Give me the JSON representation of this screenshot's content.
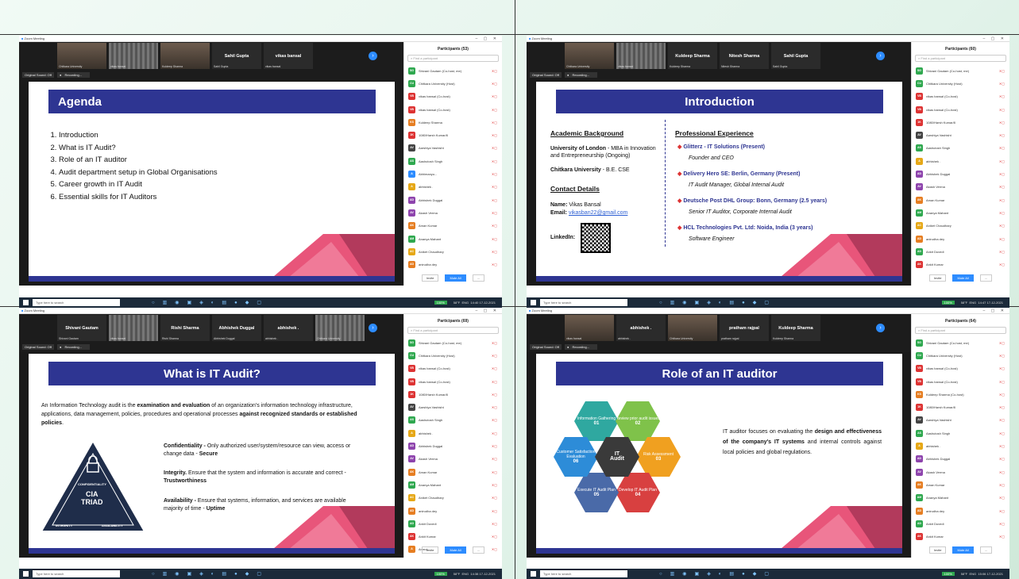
{
  "q1": {
    "window_title": "Zoom Meeting",
    "participants_count": "Participants (53)",
    "tiles": [
      {
        "name": "",
        "sub": "Chitkara University"
      },
      {
        "name": "",
        "sub": "vikas bansal"
      },
      {
        "name": "",
        "sub": "Kuldeep Sharma"
      },
      {
        "name": "Sahil Gupta",
        "sub": "Sahil Gupta"
      },
      {
        "name": "vikas bansal",
        "sub": "vikas bansal"
      }
    ],
    "participants": [
      {
        "i": "SG",
        "c": "#2fa84f",
        "n": "Shivani Gautam (Co-host, me)"
      },
      {
        "i": "CU",
        "c": "#2fa84f",
        "n": "Chitkara University (Host)"
      },
      {
        "i": "VB",
        "c": "#d33",
        "n": "vikas bansal (Co-host)"
      },
      {
        "i": "VB",
        "c": "#d33",
        "n": "vikas bansal (Co-host)"
      },
      {
        "i": "KS",
        "c": "#e67e22",
        "n": "Kuldeep Sharma"
      },
      {
        "i": "1K",
        "c": "#d33",
        "n": "1080/Harsh Kumar/8"
      },
      {
        "i": "AV",
        "c": "#444",
        "n": "Aarshiya Vashisht"
      },
      {
        "i": "AS",
        "c": "#2fa84f",
        "n": "Aashutosh Singh"
      },
      {
        "i": "A",
        "c": "#2d8cff",
        "n": "Abhimanyu..."
      },
      {
        "i": "A",
        "c": "#e6a817",
        "n": "abhishek ."
      },
      {
        "i": "AD",
        "c": "#8e44ad",
        "n": "Abhishek Duggal"
      },
      {
        "i": "AV",
        "c": "#8e44ad",
        "n": "Akash Verma"
      },
      {
        "i": "AK",
        "c": "#e67e22",
        "n": "Aman Kumar"
      },
      {
        "i": "AM",
        "c": "#2fa84f",
        "n": "Ananya Mahant"
      },
      {
        "i": "AC",
        "c": "#e6a817",
        "n": "Aniket Chaudhary"
      },
      {
        "i": "AD",
        "c": "#e67e22",
        "n": "anirudha dey"
      }
    ],
    "slide": {
      "title": "Agenda",
      "items": [
        "Introduction",
        "What is IT Audit?",
        "Role of an IT auditor",
        "Audit department setup in Global Organisations",
        "Career growth in IT Audit",
        "Essential skills for IT Auditors"
      ]
    }
  },
  "q2": {
    "window_title": "Zoom Meeting",
    "participants_count": "Participants (60)",
    "tiles": [
      {
        "name": "",
        "sub": "Chitkara University"
      },
      {
        "name": "",
        "sub": "vikas bansal"
      },
      {
        "name": "Kuldeep Sharma",
        "sub": "Kuldeep Sharma"
      },
      {
        "name": "Nitesh Sharma",
        "sub": "Nitesh Sharma"
      },
      {
        "name": "Sahil Gupta",
        "sub": "Sahil Gupta"
      }
    ],
    "participants": [
      {
        "i": "SG",
        "c": "#2fa84f",
        "n": "Shivani Gautam (Co-host, me)"
      },
      {
        "i": "CU",
        "c": "#2fa84f",
        "n": "Chitkara University (Host)"
      },
      {
        "i": "VB",
        "c": "#d33",
        "n": "vikas bansal (Co-host)"
      },
      {
        "i": "VB",
        "c": "#d33",
        "n": "vikas bansal (Co-host)"
      },
      {
        "i": "1K",
        "c": "#d33",
        "n": "1080/Harsh Kumar/8"
      },
      {
        "i": "AV",
        "c": "#444",
        "n": "Aarshiya Vashisht"
      },
      {
        "i": "AS",
        "c": "#2fa84f",
        "n": "Aashutosh Singh"
      },
      {
        "i": "A",
        "c": "#e6a817",
        "n": "abhishek ."
      },
      {
        "i": "AD",
        "c": "#8e44ad",
        "n": "Abhishek Duggal"
      },
      {
        "i": "AV",
        "c": "#8e44ad",
        "n": "Akash Verma"
      },
      {
        "i": "AK",
        "c": "#e67e22",
        "n": "Aman Kumar"
      },
      {
        "i": "AM",
        "c": "#2fa84f",
        "n": "Ananya Mahant"
      },
      {
        "i": "AC",
        "c": "#e6a817",
        "n": "Aniket Chaudhary"
      },
      {
        "i": "AD",
        "c": "#e67e22",
        "n": "anirudha dey"
      },
      {
        "i": "AD",
        "c": "#2fa84f",
        "n": "Ankit Duvedi"
      },
      {
        "i": "AK",
        "c": "#d33",
        "n": "Ankit Kumar"
      }
    ],
    "slide": {
      "title": "Introduction",
      "academic_heading": "Academic Background",
      "uni1_name": "University of London",
      "uni1_rest": " - MBA in Innovation and Entrepreneurship (Ongoing)",
      "uni2_name": "Chitkara University",
      "uni2_rest": " - B.E. CSE",
      "contact_heading": "Contact Details",
      "name_label": "Name:",
      "name_value": " Vikas Bansal",
      "email_label": "Email:",
      "email_value": "vikasban22@gmail.com",
      "linkedin_label": "LinkedIn:",
      "prof_heading": "Professional Experience",
      "jobs": [
        {
          "co": "Glitterz - IT Solutions (Present)",
          "role": "Founder and CEO"
        },
        {
          "co": "Delivery Hero SE: Berlin, Germany (Present)",
          "role": "IT Audit Manager, Global Internal Audit"
        },
        {
          "co": "Deutsche Post DHL Group: Bonn, Germany (2.5 years)",
          "role": "Senior IT Auditor, Corporate Internal Audit"
        },
        {
          "co": "HCL Technologies Pvt. Ltd: Noida, India (3 years)",
          "role": "Software Engineer"
        }
      ]
    }
  },
  "q3": {
    "window_title": "Zoom Meeting",
    "participants_count": "Participants (69)",
    "tiles": [
      {
        "name": "Shivani Gautam",
        "sub": "Shivani Gautam"
      },
      {
        "name": "",
        "sub": "vikas bansal"
      },
      {
        "name": "Rishi Sharma",
        "sub": "Rishi Sharma"
      },
      {
        "name": "Abhishek Duggal",
        "sub": "Abhishek Duggal"
      },
      {
        "name": "abhishek .",
        "sub": "abhishek ."
      },
      {
        "name": "",
        "sub": "Chitkara University"
      }
    ],
    "participants": [
      {
        "i": "SG",
        "c": "#2fa84f",
        "n": "Shivani Gautam (Co-host, me)"
      },
      {
        "i": "CU",
        "c": "#2fa84f",
        "n": "Chitkara University (Host)"
      },
      {
        "i": "VB",
        "c": "#d33",
        "n": "vikas bansal (Co-host)"
      },
      {
        "i": "VB",
        "c": "#d33",
        "n": "vikas bansal (Co-host)"
      },
      {
        "i": "1K",
        "c": "#d33",
        "n": "1080/Harsh Kumar/8"
      },
      {
        "i": "AV",
        "c": "#444",
        "n": "Aarshiya Vashisht"
      },
      {
        "i": "AS",
        "c": "#2fa84f",
        "n": "Aashutosh Singh"
      },
      {
        "i": "A",
        "c": "#e6a817",
        "n": "abhishek ."
      },
      {
        "i": "AD",
        "c": "#8e44ad",
        "n": "Abhishek Duggal"
      },
      {
        "i": "AV",
        "c": "#8e44ad",
        "n": "Akash Verma"
      },
      {
        "i": "AK",
        "c": "#e67e22",
        "n": "Aman Kumar"
      },
      {
        "i": "AM",
        "c": "#2fa84f",
        "n": "Ananya Mahant"
      },
      {
        "i": "AC",
        "c": "#e6a817",
        "n": "Aniket Chaudhary"
      },
      {
        "i": "AD",
        "c": "#e67e22",
        "n": "anirudha dey"
      },
      {
        "i": "AD",
        "c": "#2fa84f",
        "n": "Ankit Duvedi"
      },
      {
        "i": "AK",
        "c": "#d33",
        "n": "Ankit Kumar"
      },
      {
        "i": "A",
        "c": "#e67e22",
        "n": "Anmol..."
      }
    ],
    "slide": {
      "title": "What is IT Audit?",
      "intro_a": "An Information Technology audit is the ",
      "intro_b": "examination and evaluation",
      "intro_c": " of an organization's information technology infrastructure, applications, data management, policies, procedures and operational processes ",
      "intro_d": "against recognized standards or established policies",
      "intro_e": ".",
      "conf_h": "Confidentiality -",
      "conf_t": " Only authorized user/system/resource can view, access or change data - ",
      "conf_b": "Secure",
      "int_h": "Integrity.",
      "int_t": " Ensure that the system and information is accurate and correct - ",
      "int_b": "Trustworthiness",
      "av_h": "Availability -",
      "av_t": " Ensure that systems, information, and services are available majority of time - ",
      "av_b": "Uptime",
      "tri_conf": "CONFIDENTIALITY",
      "tri_cia": "CIA",
      "tri_triad": "TRIAD",
      "tri_int": "INTEGRITY",
      "tri_av": "AVAILABILITY"
    }
  },
  "q4": {
    "window_title": "Zoom Meeting",
    "participants_count": "Participants (64)",
    "tiles": [
      {
        "name": "",
        "sub": "vikas bansal"
      },
      {
        "name": "abhishek .",
        "sub": "abhishek ."
      },
      {
        "name": "",
        "sub": "Chitkara University"
      },
      {
        "name": "pratham rajpal",
        "sub": "pratham rajpal"
      },
      {
        "name": "Kuldeep Sharma",
        "sub": "Kuldeep Sharma"
      }
    ],
    "participants": [
      {
        "i": "SG",
        "c": "#2fa84f",
        "n": "Shivani Gautam (Co-host, me)"
      },
      {
        "i": "CU",
        "c": "#2fa84f",
        "n": "Chitkara University (Host)"
      },
      {
        "i": "VB",
        "c": "#d33",
        "n": "vikas bansal (Co-host)"
      },
      {
        "i": "VB",
        "c": "#d33",
        "n": "vikas bansal (Co-host)"
      },
      {
        "i": "KS",
        "c": "#e67e22",
        "n": "Kuldeep Sharma (Co-host)"
      },
      {
        "i": "1K",
        "c": "#d33",
        "n": "1080/Harsh Kumar/8"
      },
      {
        "i": "AV",
        "c": "#444",
        "n": "Aarshiya Vashisht"
      },
      {
        "i": "AS",
        "c": "#2fa84f",
        "n": "Aashutosh Singh"
      },
      {
        "i": "A",
        "c": "#e6a817",
        "n": "abhishek ."
      },
      {
        "i": "AD",
        "c": "#8e44ad",
        "n": "Abhishek Duggal"
      },
      {
        "i": "AV",
        "c": "#8e44ad",
        "n": "Akash Verma"
      },
      {
        "i": "AK",
        "c": "#e67e22",
        "n": "Aman Kumar"
      },
      {
        "i": "AM",
        "c": "#2fa84f",
        "n": "Ananya Mahant"
      },
      {
        "i": "AD",
        "c": "#e67e22",
        "n": "anirudha dey"
      },
      {
        "i": "AD",
        "c": "#2fa84f",
        "n": "Ankit Duvedi"
      },
      {
        "i": "AK",
        "c": "#d33",
        "n": "Ankit Kumar"
      }
    ],
    "slide": {
      "title": "Role of an IT auditor",
      "hex": [
        {
          "t": "Information Gathering",
          "n": "01"
        },
        {
          "t": "Review prior audit issues",
          "n": "02"
        },
        {
          "t": "Risk Assessment",
          "n": "03"
        },
        {
          "t": "Develop IT Audit Plan",
          "n": "04"
        },
        {
          "t": "Execute IT Audit Plan",
          "n": "05"
        },
        {
          "t": "Customer Satisfaction Evaluation",
          "n": "06"
        }
      ],
      "center_a": "IT",
      "center_b": "Audit",
      "desc_a": "IT auditor focuses on evaluating the ",
      "desc_b": "design and effectiveness of the company's IT systems",
      "desc_c": " and internal controls against local policies  and global regulations."
    }
  },
  "common": {
    "find_placeholder": "Find a participant",
    "invite": "Invite",
    "mute_all": "Mute All",
    "more": "...",
    "sound": "Original Sound: Off",
    "recording": "Recording...",
    "taskbar_search": "Type here to search",
    "battery": "100%",
    "weather": "58°F",
    "lang": "ENG",
    "time_q1": "14:40",
    "time_q2": "14:47",
    "time_q3": "14:38",
    "time_q4": "15:06",
    "date": "17-12-2021"
  }
}
